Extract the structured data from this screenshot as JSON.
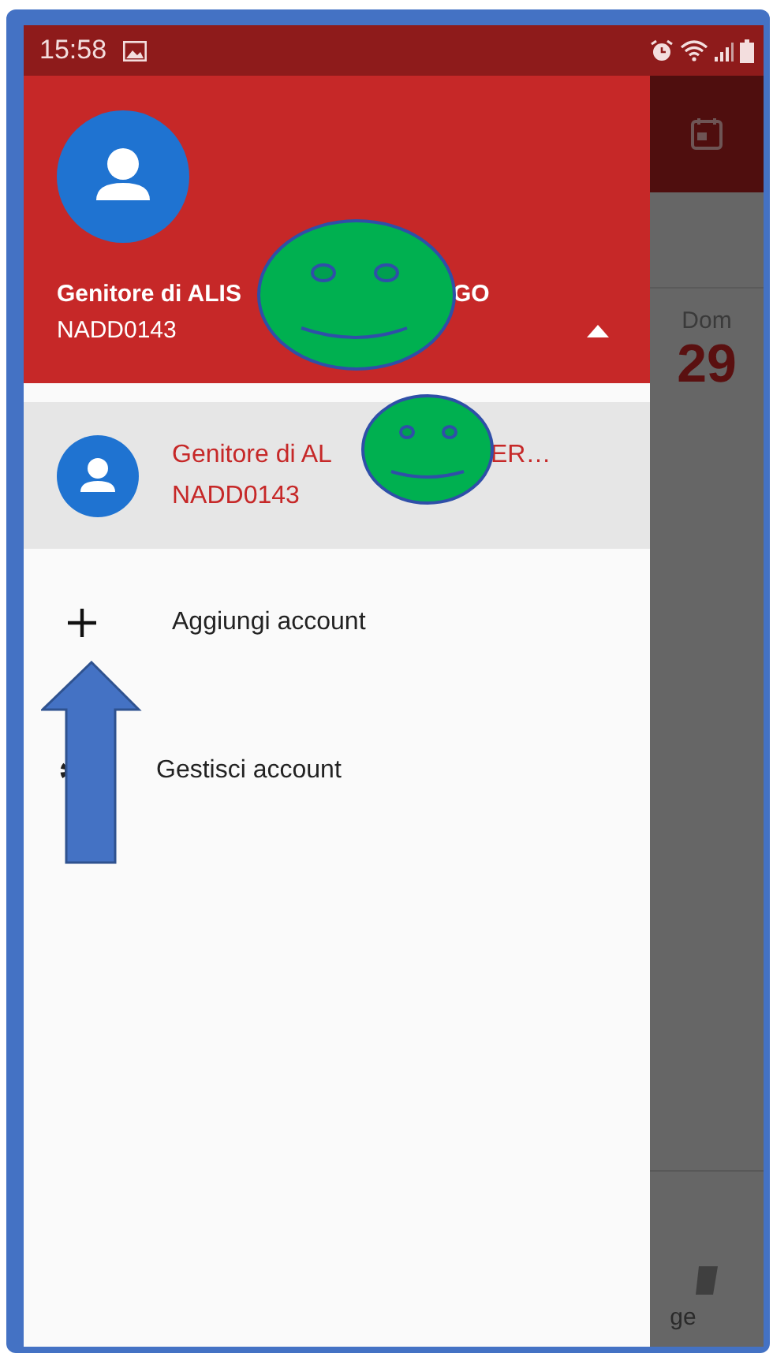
{
  "status_bar": {
    "time": "15:58"
  },
  "drawer": {
    "header": {
      "name_visible_start": "Genitore di ALIS",
      "name_visible_end": "GO",
      "code": "NADD0143",
      "expanded": true
    },
    "accounts": [
      {
        "name_start": "Genitore di AL",
        "name_end": "ER…",
        "code": "NADD0143",
        "selected": true
      }
    ],
    "menu": [
      {
        "label": "Aggiungi account",
        "kind": "add"
      },
      {
        "label": "Gestisci account",
        "kind": "manage"
      }
    ]
  },
  "background_app": {
    "day": "Dom",
    "date": "29",
    "nav_label_fragment": "ge"
  }
}
